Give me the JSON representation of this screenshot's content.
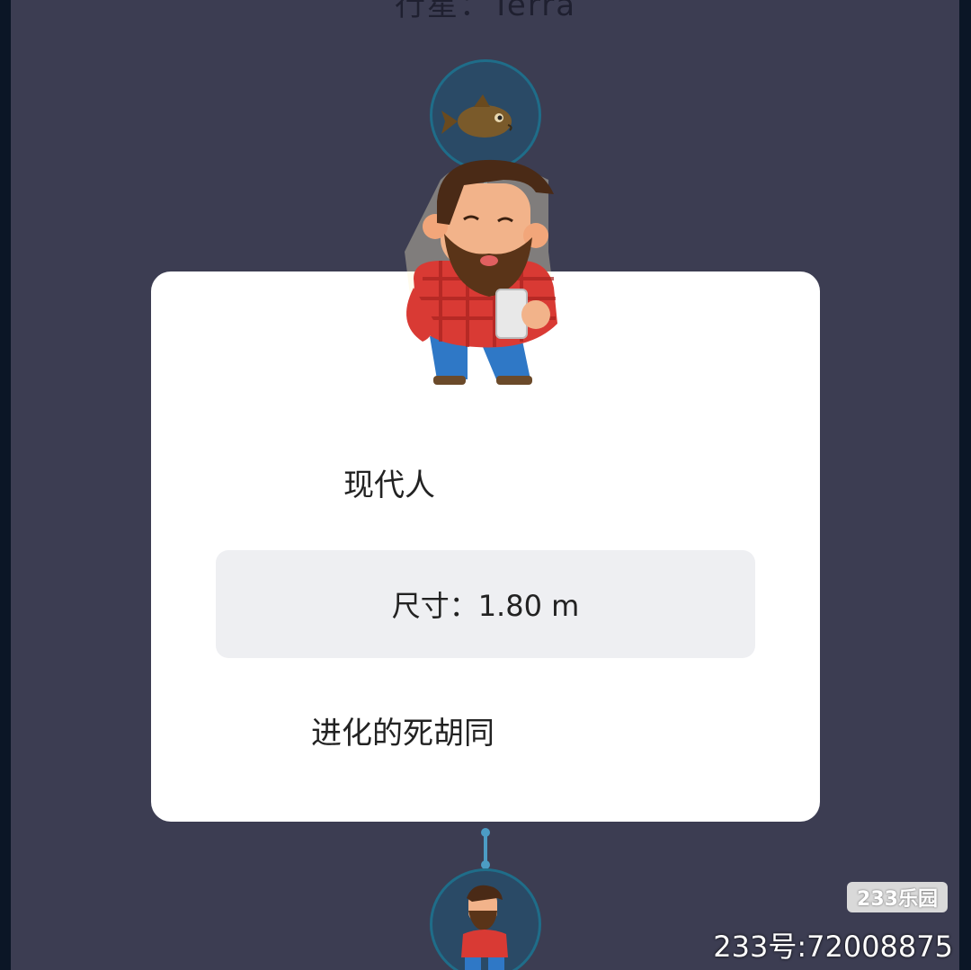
{
  "planet_label": "行星：Terra",
  "card": {
    "species_name": "现代人",
    "size_text": "尺寸：1.80 m",
    "evolution_text": "进化的死胡同"
  },
  "watermark": {
    "badge": "233乐园",
    "id_text": "233号:72008875"
  },
  "colors": {
    "background": "#3c3d52",
    "card": "#ffffff",
    "size_box": "#eeeff2",
    "node_ring": "#1f6d89"
  }
}
